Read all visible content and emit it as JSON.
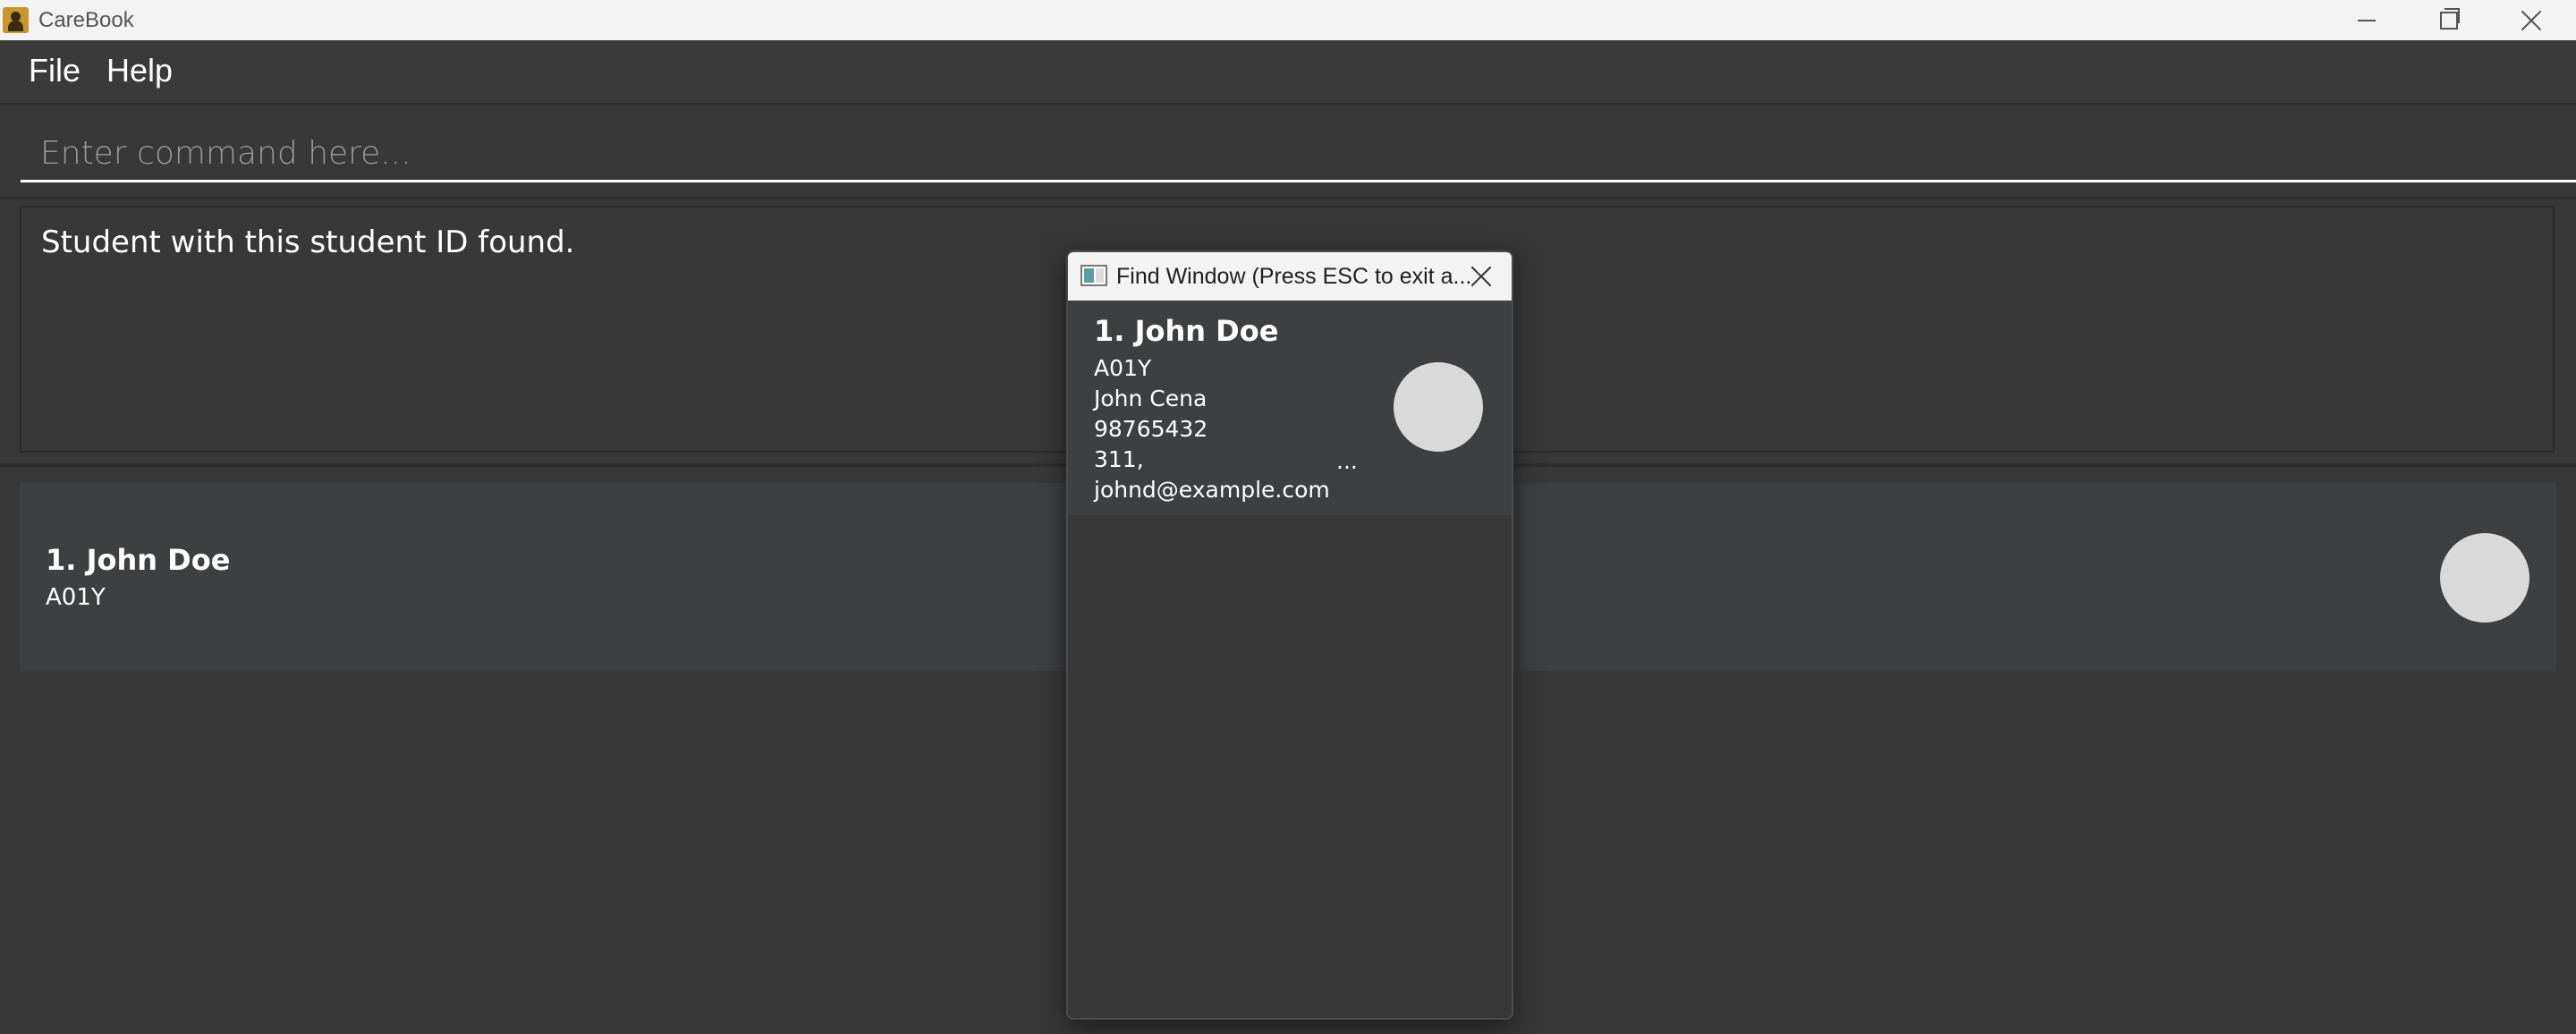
{
  "window": {
    "title": "CareBook",
    "minimize_icon": "minimize-icon",
    "maximize_icon": "restore-icon",
    "close_icon": "close-icon"
  },
  "menu": {
    "file_label": "File",
    "help_label": "Help"
  },
  "command": {
    "value": "",
    "placeholder": "Enter command here..."
  },
  "result": {
    "message": "Student with this student ID found."
  },
  "person_list": [
    {
      "name": "1. John Doe",
      "student_id": "A01Y"
    }
  ],
  "find_window": {
    "title": "Find Window (Press ESC to exit a...",
    "person": {
      "name": "1. John Doe",
      "student_id": "A01Y",
      "guardian": "John Cena",
      "phone": "98765432",
      "address": "311,",
      "address_ellipsis": "...",
      "email": "johnd@example.com"
    }
  },
  "colors": {
    "background": "#383838",
    "card": "#3e3f41",
    "titlebar": "#f3f3f3",
    "avatar": "#d9d9d9",
    "text": "#ffffff"
  }
}
